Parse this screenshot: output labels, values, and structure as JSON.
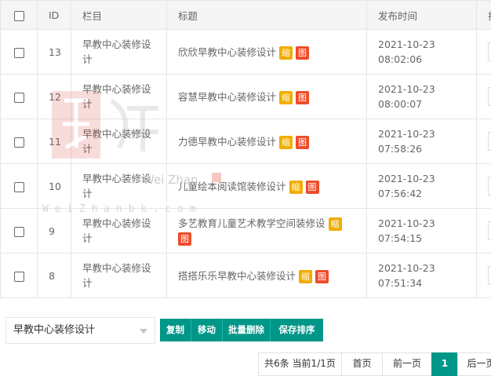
{
  "table": {
    "headers": {
      "id": "ID",
      "category": "栏目",
      "title": "标题",
      "published": "发布时间",
      "extra": "排"
    },
    "rows": [
      {
        "id": "13",
        "category_line1": "早教中心装修设",
        "category_line2": "计",
        "title_line1": "欣欣早教中心装修设计",
        "title_line2": "",
        "badge_thumb": "缩",
        "badge_pic": "图",
        "date": "2021-10-23",
        "time": "08:02:06"
      },
      {
        "id": "12",
        "category_line1": "早教中心装修设",
        "category_line2": "计",
        "title_line1": "容慧早教中心装修设计",
        "title_line2": "",
        "badge_thumb": "缩",
        "badge_pic": "图",
        "date": "2021-10-23",
        "time": "08:00:07"
      },
      {
        "id": "11",
        "category_line1": "早教中心装修设",
        "category_line2": "计",
        "title_line1": "力德早教中心装修设计",
        "title_line2": "",
        "badge_thumb": "缩",
        "badge_pic": "图",
        "date": "2021-10-23",
        "time": "07:58:26"
      },
      {
        "id": "10",
        "category_line1": "早教中心装修设",
        "category_line2": "计",
        "title_line1": "儿童绘本阅读馆装修设计",
        "title_line2": "",
        "badge_thumb": "缩",
        "badge_pic": "图",
        "date": "2021-10-23",
        "time": "07:56:42"
      },
      {
        "id": "9",
        "category_line1": "早教中心装修设",
        "category_line2": "计",
        "title_line1": "多艺教育儿童艺术教学空间装修设",
        "title_line2": "",
        "badge_thumb": "缩",
        "badge_pic": "图",
        "date": "2021-10-23",
        "time": "07:54:15"
      },
      {
        "id": "8",
        "category_line1": "早教中心装修设",
        "category_line2": "计",
        "title_line1": "搭搭乐乐早教中心装修设计",
        "title_line2": "",
        "badge_thumb": "缩",
        "badge_pic": "图",
        "date": "2021-10-23",
        "time": "07:51:34"
      }
    ]
  },
  "watermark": {
    "en_a": "Wei Zhan",
    "en_b": "W e i Z h a n b k . c o m",
    "icon": "weizhan-logo-icon"
  },
  "footer": {
    "category_select_value": "早教中心装修设计",
    "actions": [
      "复制",
      "移动",
      "批量删除",
      "保存排序"
    ],
    "pager": {
      "summary": "共6条 当前1/1页",
      "first": "首页",
      "prev": "前一页",
      "current": "1",
      "next": "后一页"
    }
  },
  "colors": {
    "accent": "#009688",
    "thumb_badge": "#f0ad00",
    "pic_badge": "#ef4c2a"
  }
}
